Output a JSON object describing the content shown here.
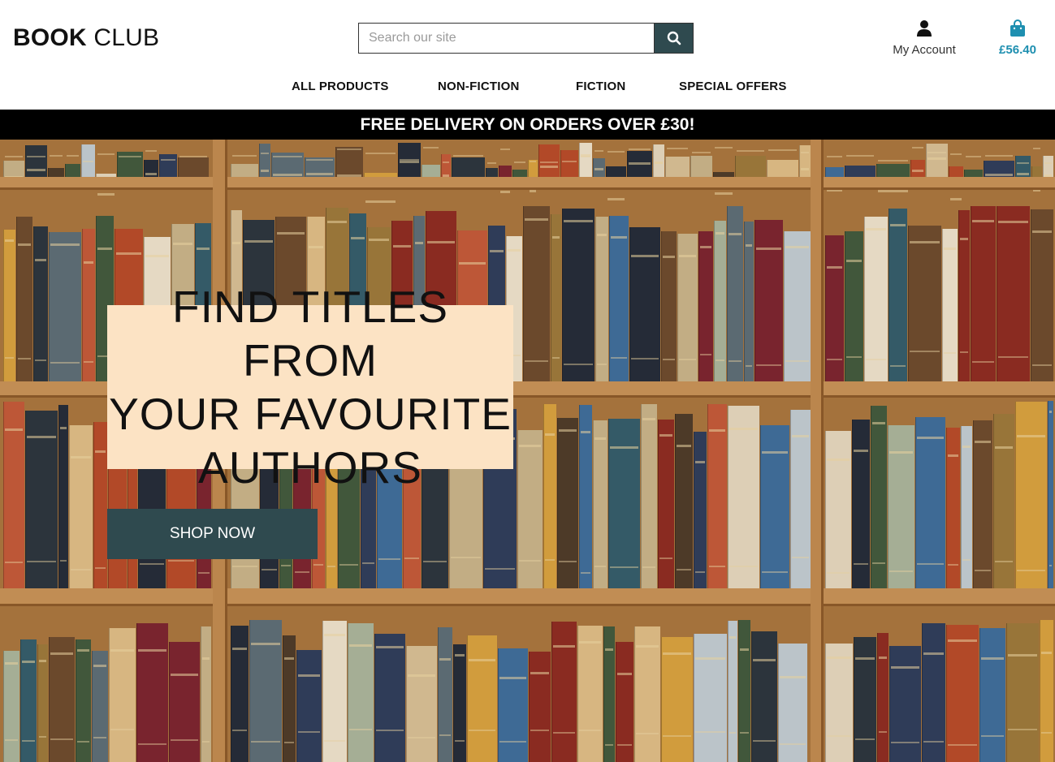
{
  "header": {
    "logo_bold": "BOOK",
    "logo_rest": " CLUB",
    "search_placeholder": "Search our site",
    "search_icon": "search-icon",
    "account_label": "My Account",
    "account_icon": "user-icon",
    "cart_total": "£56.40",
    "cart_icon": "shopping-bag-icon"
  },
  "nav": {
    "items": [
      "ALL PRODUCTS",
      "NON-FICTION",
      "FICTION",
      "SPECIAL OFFERS"
    ]
  },
  "banner": {
    "text": "FREE DELIVERY ON ORDERS OVER £30!"
  },
  "hero": {
    "headline_lines": [
      "FIND TITLES FROM",
      "YOUR FAVOURITE",
      "AUTHORS"
    ],
    "cta_label": "SHOP NOW",
    "background": "bookshelf-photo"
  },
  "colors": {
    "primary": "#2f4a4f",
    "cart_accent": "#1e8fb0",
    "headline_box": "#fce3c4",
    "banner_bg": "#000000"
  }
}
